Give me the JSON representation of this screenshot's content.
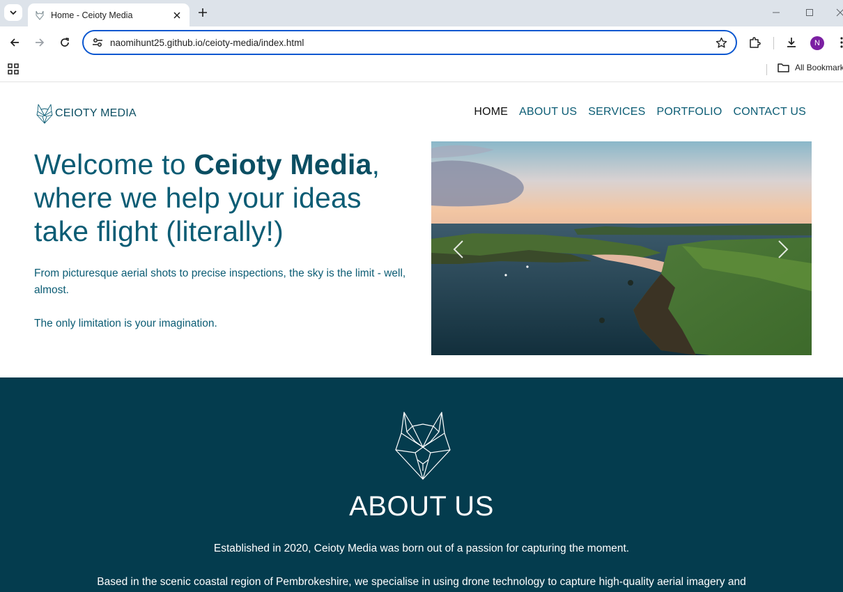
{
  "browser": {
    "tab_title": "Home - Ceioty Media",
    "url": "naomihunt25.github.io/ceioty-media/index.html",
    "profile_initial": "N",
    "bookmarks_label": "All Bookmarks",
    "accent_color": "#0b57d0",
    "profile_color": "#7b1fa2"
  },
  "site": {
    "brand": "CEIOTY MEDIA",
    "nav": [
      {
        "label": "HOME",
        "active": true
      },
      {
        "label": "ABOUT US",
        "active": false
      },
      {
        "label": "SERVICES",
        "active": false
      },
      {
        "label": "PORTFOLIO",
        "active": false
      },
      {
        "label": "CONTACT US",
        "active": false
      }
    ],
    "hero": {
      "title_prefix": "Welcome to ",
      "title_brand": "Ceioty Media",
      "title_suffix": ", where we help your ideas take flight (literally!)",
      "paragraph_1": "From picturesque aerial shots to precise inspections, the sky is the limit - well, almost.",
      "paragraph_2": "The only limitation is your imagination."
    },
    "about": {
      "heading": "ABOUT US",
      "paragraph_1": "Established in 2020, Ceioty Media was born out of a passion for capturing the moment.",
      "paragraph_2": "Based in the scenic coastal region of Pembrokeshire, we specialise in using drone technology to capture high-quality aerial imagery and"
    },
    "colors": {
      "primary_text": "#0b5c74",
      "about_background": "#043c4e"
    }
  }
}
